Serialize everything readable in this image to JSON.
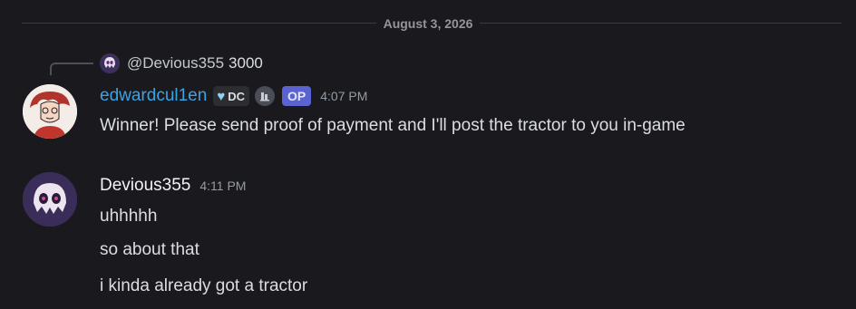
{
  "date_divider": "August 3, 2026",
  "reply": {
    "author": "@Devious355",
    "text": "3000"
  },
  "messages": [
    {
      "author": "edwardcul1en",
      "tag": "DC",
      "badge": "OP",
      "time": "4:07 PM",
      "lines": [
        "Winner! Please send proof of payment and I'll post the tractor to you in-game"
      ]
    },
    {
      "author": "Devious355",
      "time": "4:11 PM",
      "lines": [
        "uhhhhh",
        "so about that",
        "i kinda already got a tractor"
      ]
    }
  ],
  "colors": {
    "background": "#1a1a1e",
    "edward_name": "#3aa3e6",
    "op_badge": "#5b63d3"
  },
  "icons": {
    "tag_icon": "heart-icon",
    "role_icon": "role-badge-icon"
  }
}
